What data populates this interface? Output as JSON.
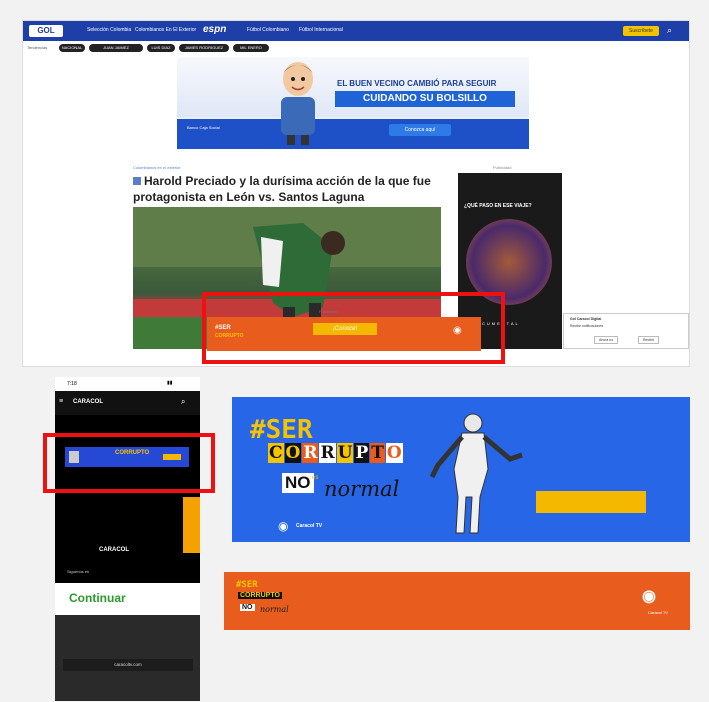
{
  "desktop": {
    "logo": "GOL",
    "nav_items": [
      "Selección Colombia",
      "Colombianos En El Exterior",
      "Fútbol Colombiano",
      "Fútbol Internacional"
    ],
    "espn": "espn",
    "subscribe": "Suscríbete",
    "tendencias_label": "Tendencias",
    "tags": [
      "NACIONAL",
      "JUAN JAIMEZ",
      "LUIS DIAZ",
      "JAMES RODRIGUEZ",
      "MIL ENERO"
    ],
    "ad": {
      "headline1": "EL BUEN VECINO CAMBIÓ PARA SEGUIR",
      "headline2": "CUIDANDO SU BOLSILLO",
      "button": "Conozca aquí",
      "bank": "Banco Caja Social"
    },
    "article": {
      "crumb": "Colombianos en el exterior",
      "published": "Publicidad",
      "headline": "Harold Preciado y la durísima acción de la que fue protagonista en León vs. Santos Laguna"
    },
    "side_ad": {
      "title": "¿QUÉ PASO EN ESE VIAJE?",
      "bottom": "DOCUMENTAL"
    },
    "sticky": {
      "label": "Publicidad",
      "button": "¡Conoce!"
    },
    "notification": {
      "title": "Gol Caracol Digital",
      "body": "Recibe notificaciones",
      "no": "Ahora no",
      "yes": "Recibir"
    }
  },
  "phone": {
    "time": "7:18",
    "logo": "CARACOL",
    "logo2": "CARACOL",
    "row": "Siguenos en",
    "continue": "Continuar",
    "url": "caracoltv.com"
  },
  "poster": {
    "ser": "#SER",
    "corrupto": [
      "C",
      "O",
      "R",
      "R",
      "U",
      "P",
      "T",
      "O"
    ],
    "no": "NO",
    "es": "es",
    "normal": "normal",
    "canal": "Caracol TV"
  },
  "orange_banner": {
    "ser": "#SER",
    "corrupto": "CORRUPTO",
    "no": "NO",
    "normal": "normal",
    "canal": "Caracol TV"
  },
  "colors": {
    "blue": "#2766e6",
    "orange": "#e85d1e",
    "yellow": "#f5b800",
    "red_frame": "#ee1111"
  }
}
